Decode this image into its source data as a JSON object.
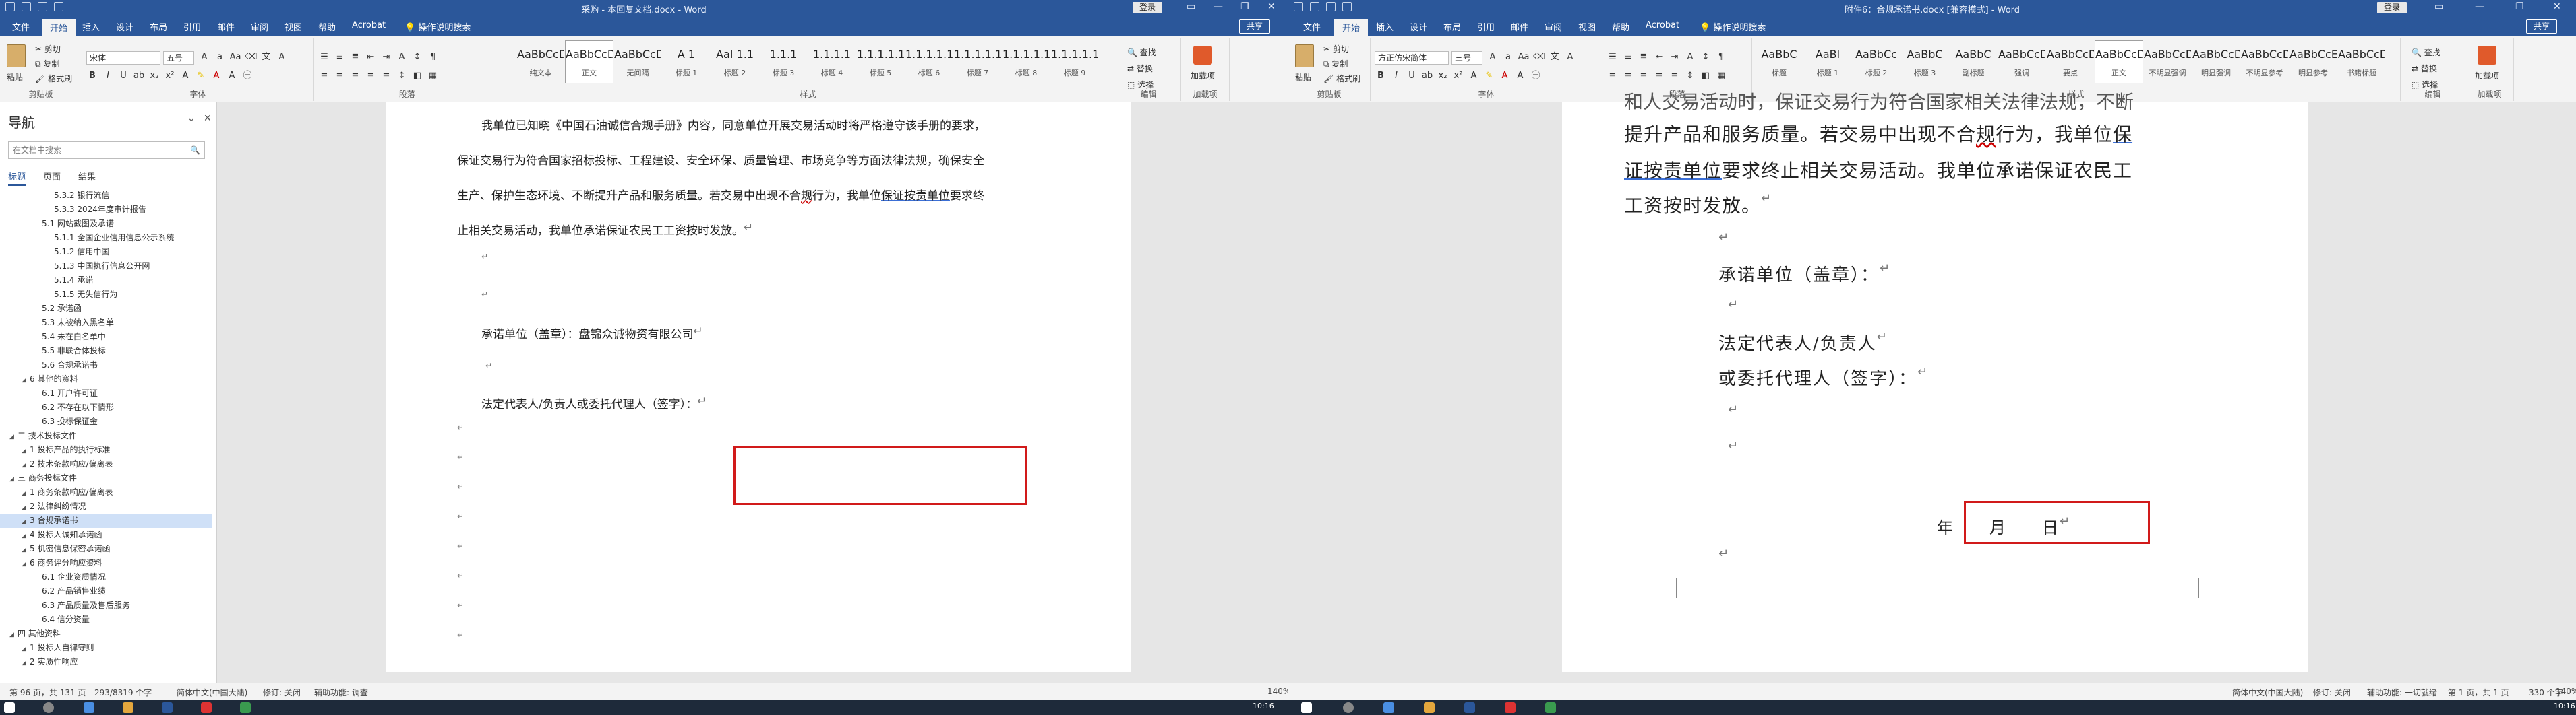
{
  "left": {
    "title": "采购 - 本回复文档.docx - Word",
    "login": "登录",
    "tabs": [
      "文件",
      "开始",
      "插入",
      "设计",
      "布局",
      "引用",
      "邮件",
      "审阅",
      "视图",
      "帮助",
      "Acrobat"
    ],
    "search": "操作说明搜索",
    "share": "共享",
    "ribbon": {
      "paste": "粘贴",
      "cut": "剪切",
      "copy": "复制",
      "format_painter": "格式刷",
      "clipboard": "剪贴板",
      "font_name": "宋体",
      "font_size": "五号",
      "font": "字体",
      "paragraph": "段落",
      "styles": "样式",
      "editing": "编辑",
      "addins": "加载项",
      "find": "查找",
      "replace": "替换",
      "select": "选择",
      "addin_btn": "加载项",
      "style_cards": [
        {
          "sample": "AaBbCcDdE",
          "name": "纯文本"
        },
        {
          "sample": "AaBbCcDdE",
          "name": "正文"
        },
        {
          "sample": "AaBbCcDdE",
          "name": "无间隔"
        },
        {
          "sample": "A 1",
          "name": "标题 1"
        },
        {
          "sample": "AaI 1.1",
          "name": "标题 2"
        },
        {
          "sample": "1.1.1",
          "name": "标题 3"
        },
        {
          "sample": "1.1.1.1",
          "name": "标题 4"
        },
        {
          "sample": "1.1.1.1.1",
          "name": "标题 5"
        },
        {
          "sample": "1.1.1.1.1",
          "name": "标题 6"
        },
        {
          "sample": "1.1.1.1.1",
          "name": "标题 7"
        },
        {
          "sample": "1.1.1.1.1",
          "name": "标题 8"
        },
        {
          "sample": "1.1.1.1.1",
          "name": "标题 9"
        }
      ]
    },
    "nav": {
      "title": "导航",
      "search_placeholder": "在文档中搜索",
      "tabs": [
        "标题",
        "页面",
        "结果"
      ],
      "items": [
        "5.3.2 银行流信",
        "5.3.3 2024年度审计报告",
        "5.1 网站截图及承诺",
        "5.1.1 全国企业信用信息公示系统",
        "5.1.2 信用中国",
        "5.1.3 中国执行信息公开网",
        "5.1.4 承诺",
        "5.1.5 无失信行为",
        "5.2 承诺函",
        "5.3 未被纳入黑名单",
        "5.4 未在白名单中",
        "5.5 非联合体投标",
        "5.6 合规承诺书",
        "6 其他的资料",
        "6.1 开户许可证",
        "6.2 不存在以下情形",
        "6.3 投标保证金",
        "二 技术投标文件",
        "1 投标产品的执行标准",
        "2 技术条款响应/偏离表",
        "三 商务投标文件",
        "1 商务条款响应/偏离表",
        "2 法律纠纷情况",
        "3 合规承诺书",
        "4 投标人诚知承诺函",
        "5 机密信息保密承诺函",
        "6 商务评分响应资料",
        "6.1 企业资质情况",
        "6.2 产品销售业绩",
        "6.3 产品质量及售后服务",
        "6.4 信分资量",
        "四 其他资料",
        "1 投标人自律守则",
        "2 实质性响应"
      ]
    },
    "doc": {
      "p1": "我单位已知晓《中国石油诚信合规手册》内容，同意单位开展交易活动时将严格遵守该手册的要求，",
      "p2": "保证交易行为符合国家招标投标、工程建设、安全环保、质量管理、市场竞争等方面法律法规，确保安全",
      "p3a": "生产、保护生态环境、不断提升产品和服务质量。若交易中出现不合",
      "p3b": "规",
      "p3c": "行为，我单位",
      "p3d": "保证按责单位",
      "p3e": "要求终",
      "p4": "止相关交易活动，我单位承诺保证农民工工资按时发放。",
      "sign1": "承诺单位（盖章）：盘锦众诚物资有限公司",
      "sign2": "法定代表人/负责人或委托代理人（签字）："
    },
    "status": {
      "page": "第 96 页，共 131 页",
      "words": "293/8319 个字",
      "lang": "简体中文(中国大陆)",
      "track": "修订: 关闭",
      "access": "辅助功能: 调查"
    },
    "zoom": "140%"
  },
  "right": {
    "title": "附件6：合规承诺书.docx [兼容模式] - Word",
    "login": "登录",
    "tabs": [
      "文件",
      "开始",
      "插入",
      "设计",
      "布局",
      "引用",
      "邮件",
      "审阅",
      "视图",
      "帮助",
      "Acrobat"
    ],
    "search": "操作说明搜索",
    "share": "共享",
    "ribbon": {
      "paste": "粘贴",
      "cut": "剪切",
      "copy": "复制",
      "format_painter": "格式刷",
      "clipboard": "剪贴板",
      "font_name": "方正仿宋简体",
      "font_size": "三号",
      "font": "字体",
      "paragraph": "段落",
      "styles": "样式",
      "editing": "编辑",
      "addins": "加载项",
      "find": "查找",
      "replace": "替换",
      "select": "选择",
      "addin_btn": "加载项",
      "style_cards": [
        {
          "sample": "AaBbC",
          "name": "标题"
        },
        {
          "sample": "AaBl",
          "name": "标题 1"
        },
        {
          "sample": "AaBbCc",
          "name": "标题 2"
        },
        {
          "sample": "AaBbC",
          "name": "标题 3"
        },
        {
          "sample": "AaBbC",
          "name": "副标题"
        },
        {
          "sample": "AaBbCcDc",
          "name": "强调"
        },
        {
          "sample": "AaBbCcD",
          "name": "要点"
        },
        {
          "sample": "AaBbCcDd",
          "name": "正文"
        },
        {
          "sample": "AaBbCcDc",
          "name": "不明显强调"
        },
        {
          "sample": "AaBbCcDc",
          "name": "明显强调"
        },
        {
          "sample": "AaBbCcDc",
          "name": "不明显参考"
        },
        {
          "sample": "AaBbCcE",
          "name": "明显参考"
        },
        {
          "sample": "AaBbCcDc",
          "name": "书籍标题"
        }
      ]
    },
    "doc": {
      "l0": "和人交易活动时，保证交易行为符合国家相关法律法规，不断",
      "l1a": "提升产品和服务质量。若交易中出现不合",
      "l1b": "规",
      "l1c": "行为，我单位",
      "l1d": "保",
      "l2a": "证按责单位",
      "l2b": "要求终止相关交易活动。我单位承诺保证农民工",
      "l3": "工资按时发放。",
      "sign1": "承诺单位（盖章）：",
      "sign2": "法定代表人/负责人",
      "sign3": "或委托代理人（签字）：",
      "date": "年　　月　　日"
    },
    "status": {
      "page": "第 1 页，共 1 页",
      "words": "330 个字",
      "lang": "简体中文(中国大陆)",
      "track": "修订: 关闭",
      "access": "辅助功能: 一切就绪"
    },
    "zoom": "140%"
  },
  "taskbar": {
    "time_left": "10:16",
    "time_right": "10:16"
  }
}
